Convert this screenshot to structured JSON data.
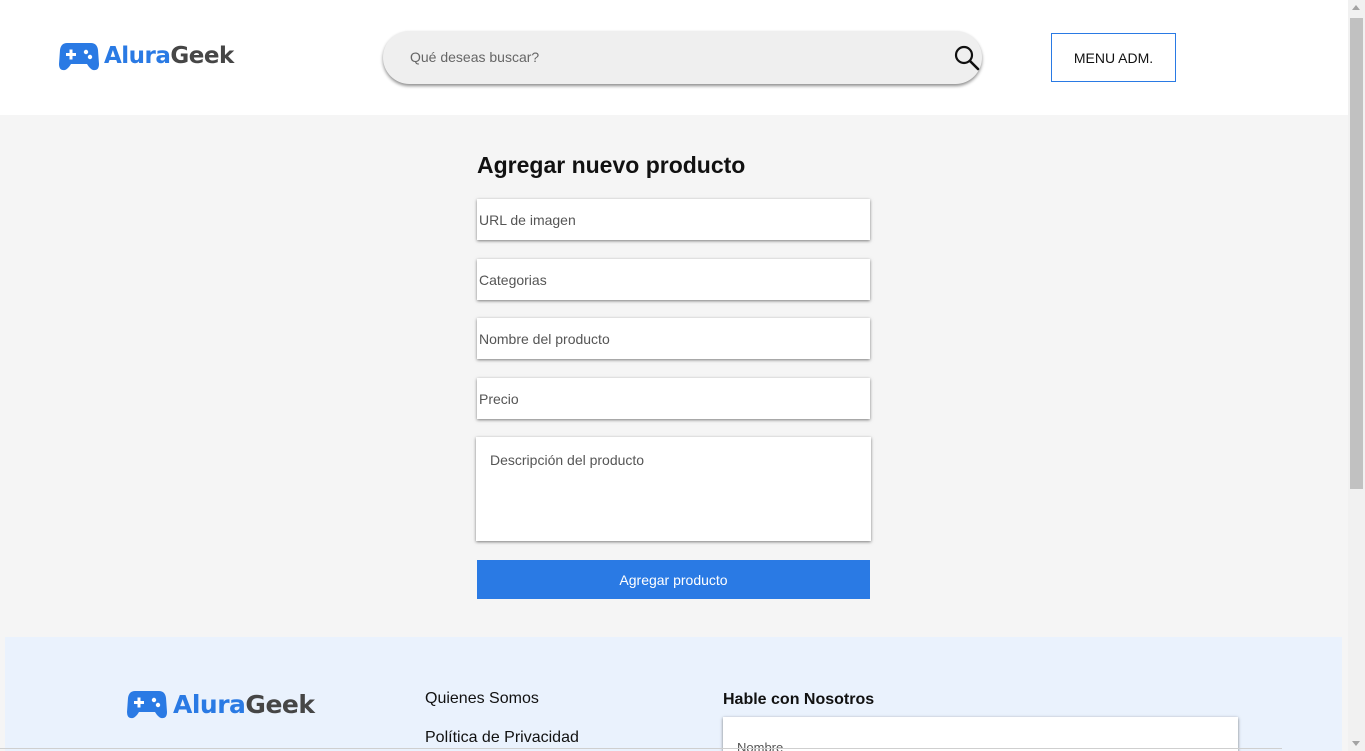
{
  "header": {
    "logo": {
      "brand_part1": "Alura",
      "brand_part2": "Geek",
      "icon": "gamepad-icon"
    },
    "search": {
      "placeholder": "Qué deseas buscar?",
      "icon": "search-icon"
    },
    "menu_button_label": "MENU ADM."
  },
  "form": {
    "title": "Agregar nuevo producto",
    "fields": {
      "image_url_placeholder": "URL de imagen",
      "category_placeholder": "Categorias",
      "name_placeholder": "Nombre del producto",
      "price_placeholder": "Precio",
      "description_placeholder": "Descripción del producto"
    },
    "submit_label": "Agregar producto"
  },
  "footer": {
    "logo": {
      "brand_part1": "Alura",
      "brand_part2": "Geek"
    },
    "links": [
      "Quienes Somos",
      "Política de Privacidad"
    ],
    "contact": {
      "title": "Hable con Nosotros",
      "name_placeholder": "Nombre"
    }
  },
  "colors": {
    "accent": "#2a7ae4",
    "footer_bg": "#eaf2fd",
    "page_bg": "#f5f5f5"
  }
}
